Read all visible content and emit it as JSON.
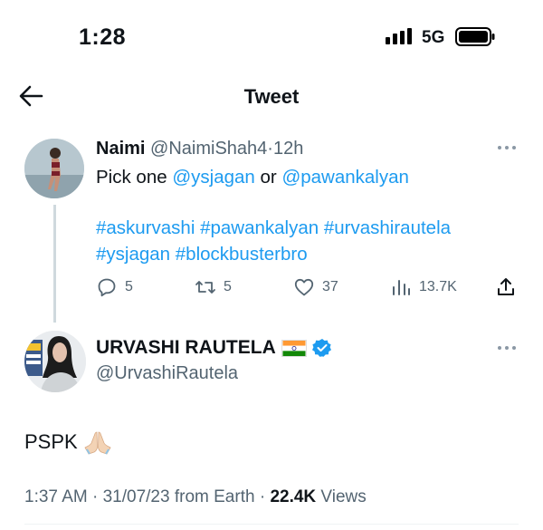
{
  "status_bar": {
    "time": "1:28",
    "network": "5G"
  },
  "header": {
    "title": "Tweet"
  },
  "reply_tweet": {
    "name": "Naimi",
    "handle": "@NaimiShah4",
    "separator": "·",
    "time": "12h",
    "text_prefix": "Pick one ",
    "mention_1": "@ysjagan",
    "text_middle": " or ",
    "mention_2": "@pawankalyan",
    "hashtags_line1": [
      "#askurvashi",
      "#pawankalyan",
      "#urvashirautela"
    ],
    "hashtags_line2": [
      "#ysjagan",
      "#blockbusterbro"
    ],
    "actions": {
      "replies": "5",
      "retweets": "5",
      "likes": "37",
      "views": "13.7K"
    }
  },
  "main_tweet": {
    "name": "URVASHI RAUTELA",
    "handle": "@UrvashiRautela",
    "text": "PSPK",
    "emoji": "folded-hands",
    "meta": {
      "time": "1:37 AM",
      "sep1": " · ",
      "date": "31/07/23",
      "source": " from Earth",
      "sep2": " · ",
      "views_count": "22.4K",
      "views_label": " Views"
    }
  },
  "colors": {
    "accent": "#1d9bf0",
    "secondary": "#536471",
    "text": "#0f1419",
    "verified": "#1d9bf0"
  }
}
